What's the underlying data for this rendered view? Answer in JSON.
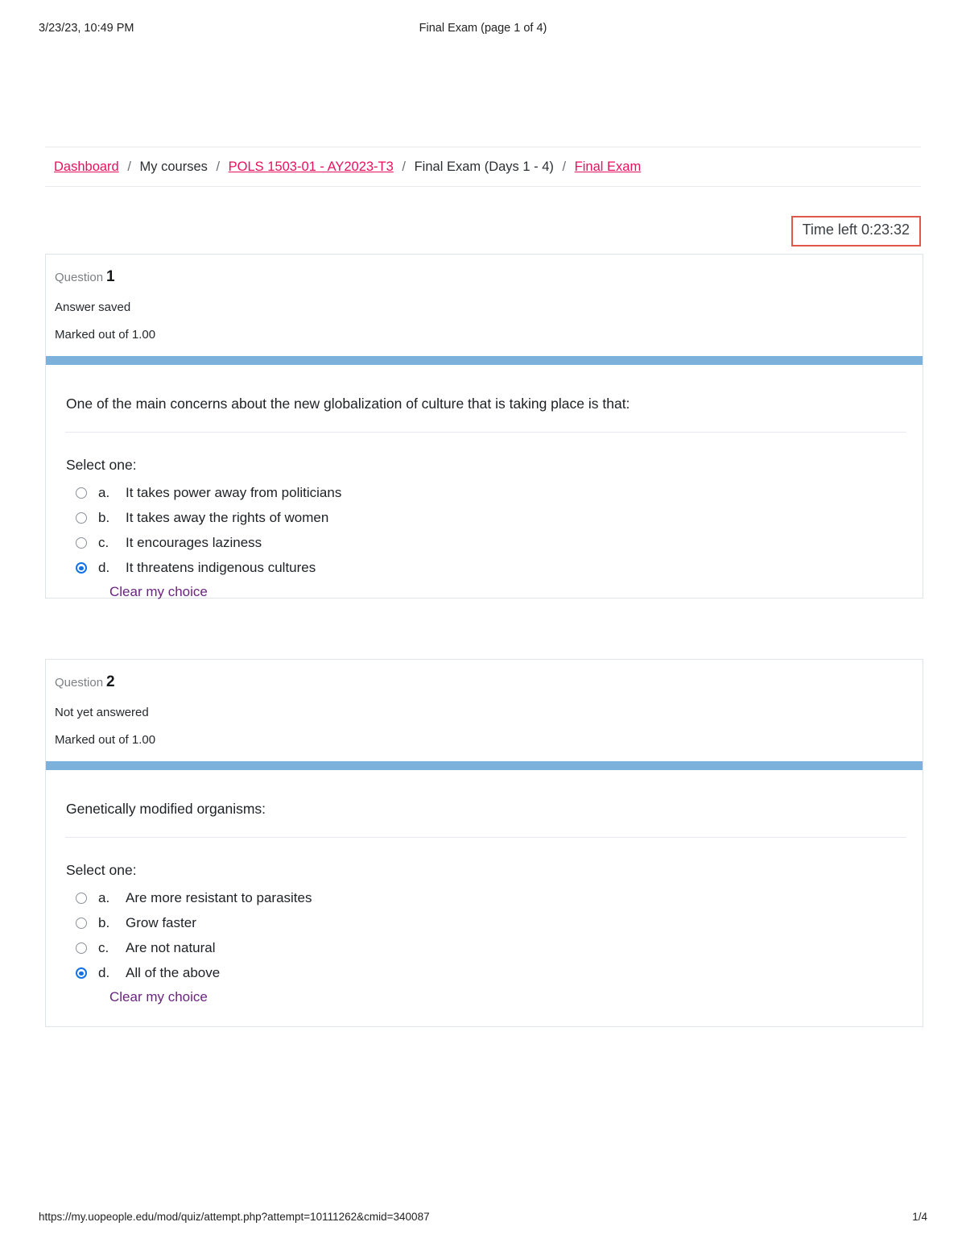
{
  "print_header": {
    "timestamp": "3/23/23, 10:49 PM",
    "title": "Final Exam (page 1 of 4)"
  },
  "print_footer": {
    "url": "https://my.uopeople.edu/mod/quiz/attempt.php?attempt=10111262&cmid=340087",
    "page": "1/4"
  },
  "breadcrumb": {
    "items": [
      {
        "label": "Dashboard",
        "link": true
      },
      {
        "label": "My courses",
        "link": false
      },
      {
        "label": "POLS 1503-01 - AY2023-T3",
        "link": true
      },
      {
        "label": "Final Exam (Days 1 - 4)",
        "link": false
      },
      {
        "label": "Final Exam",
        "link": true
      }
    ],
    "separator": "/"
  },
  "timer": {
    "label": "Time left 0:23:32",
    "border_color": "#e2574c"
  },
  "colors": {
    "breadcrumb_link": "#e6125d",
    "clear_link": "#6a2480",
    "question_bar": "#7cb1dc",
    "radio_selected": "#1273e6",
    "card_border": "#dfe3ea"
  },
  "questions": [
    {
      "number_label": "Question",
      "number": "1",
      "state": "Answer saved",
      "marks": "Marked out of 1.00",
      "text": "One of the main concerns about the new globalization of culture that is taking place is that:",
      "select_label": "Select one:",
      "options": [
        {
          "letter": "a.",
          "text": "It takes power away from politicians",
          "selected": false
        },
        {
          "letter": "b.",
          "text": "It takes away the rights of women",
          "selected": false
        },
        {
          "letter": "c.",
          "text": "It encourages laziness",
          "selected": false
        },
        {
          "letter": "d.",
          "text": "It threatens indigenous cultures",
          "selected": true
        }
      ],
      "clear_label": "Clear my choice"
    },
    {
      "number_label": "Question",
      "number": "2",
      "state": "Not yet answered",
      "marks": "Marked out of 1.00",
      "text": "Genetically modified organisms:",
      "select_label": "Select one:",
      "options": [
        {
          "letter": "a.",
          "text": "Are more resistant to parasites",
          "selected": false
        },
        {
          "letter": "b.",
          "text": "Grow faster",
          "selected": false
        },
        {
          "letter": "c.",
          "text": "Are not natural",
          "selected": false
        },
        {
          "letter": "d.",
          "text": "All of the above",
          "selected": true
        }
      ],
      "clear_label": "Clear my choice"
    }
  ]
}
